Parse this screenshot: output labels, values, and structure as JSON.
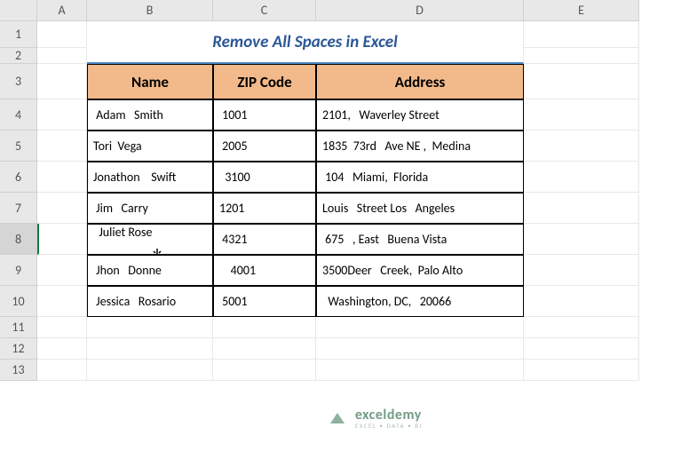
{
  "columns": [
    "A",
    "B",
    "C",
    "D",
    "E"
  ],
  "rows": [
    "1",
    "2",
    "3",
    "4",
    "5",
    "6",
    "7",
    "8",
    "9",
    "10",
    "11",
    "12",
    "13"
  ],
  "title": "Remove All Spaces in Excel",
  "active_row": 8,
  "headers": {
    "name": "Name",
    "zip": "ZIP Code",
    "address": "Address"
  },
  "chart_data": {
    "type": "table",
    "columns": [
      "Name",
      "ZIP Code",
      "Address"
    ],
    "rows": [
      {
        "name": " Adam   Smith",
        "zip": " 1001",
        "address": "2101,   Waverley Street"
      },
      {
        "name": "Tori  Vega",
        "zip": " 2005",
        "address": "1835  73rd   Ave NE ,  Medina"
      },
      {
        "name": "Jonathon    Swift",
        "zip": "  3100",
        "address": " 104   Miami,  Florida"
      },
      {
        "name": " Jim   Carry",
        "zip": "1201",
        "address": "Louis   Street Los   Angeles"
      },
      {
        "name": "  Juliet Rose",
        "zip": " 4321",
        "address": " 675   , East   Buena Vista"
      },
      {
        "name": " Jhon   Donne",
        "zip": "    4001",
        "address": "3500Deer   Creek,  Palo Alto"
      },
      {
        "name": " Jessica   Rosario",
        "zip": " 5001",
        "address": "  Washington, DC,   20066"
      }
    ]
  },
  "watermark": {
    "brand": "exceldemy",
    "tagline": "EXCEL • DATA • BI"
  }
}
